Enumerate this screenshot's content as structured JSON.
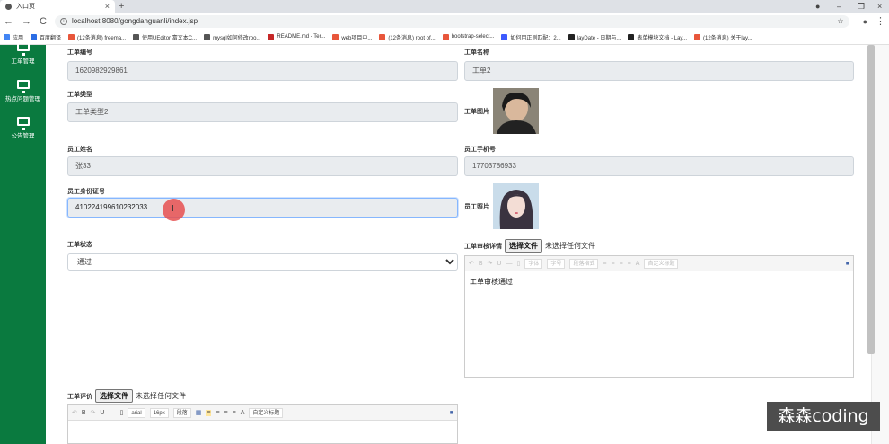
{
  "browser": {
    "tab_title": "入口页",
    "url": "localhost:8080/gongdanguanli/index.jsp",
    "bookmarks": [
      {
        "label": "应用",
        "color": "#4285f4"
      },
      {
        "label": "百度翻译",
        "color": "#2b6de5"
      },
      {
        "label": "(12条消息) freema...",
        "color": "#e8563b"
      },
      {
        "label": "使用UEditor 富文本C...",
        "color": "#555555"
      },
      {
        "label": "mysql如何修改roo...",
        "color": "#555555"
      },
      {
        "label": "README.md - Ter...",
        "color": "#c62828"
      },
      {
        "label": "web项目中...",
        "color": "#e8563b"
      },
      {
        "label": "(12条消息) root of...",
        "color": "#e8563b"
      },
      {
        "label": "bootstrap-select...",
        "color": "#e8563b"
      },
      {
        "label": "如何用正则匹配：2...",
        "color": "#3d5afe"
      },
      {
        "label": "layDate - 日期与...",
        "color": "#222222"
      },
      {
        "label": "表单模块文档 - Lay...",
        "color": "#222222"
      },
      {
        "label": "(12条消息) 关于lay...",
        "color": "#e8563b"
      }
    ]
  },
  "sidebar": {
    "items": [
      {
        "label": "工单管理",
        "icon": "monitor-icon"
      },
      {
        "label": "热点问题管理",
        "icon": "monitor-icon"
      },
      {
        "label": "公告管理",
        "icon": "monitor-icon"
      }
    ]
  },
  "form": {
    "ticket_no_label": "工单编号",
    "ticket_no_value": "1620982929861",
    "ticket_name_label": "工单名称",
    "ticket_name_value": "工单2",
    "ticket_type_label": "工单类型",
    "ticket_type_value": "工单类型2",
    "ticket_image_label": "工单图片",
    "employee_name_label": "员工姓名",
    "employee_name_value": "张33",
    "employee_phone_label": "员工手机号",
    "employee_phone_value": "17703786933",
    "employee_id_label": "员工身份证号",
    "employee_id_value": "410224199610232033",
    "employee_photo_label": "员工照片",
    "status_label": "工单状态",
    "status_value": "通过",
    "review_detail_label": "工单审核详情",
    "choose_file": "选择文件",
    "no_file": "未选择任何文件",
    "review_text": "工单审核通过",
    "evaluation_label": "工单评价",
    "editor_font": "arial",
    "editor_size": "16px",
    "editor_paragraph": "段落",
    "editor_custom_title": "自定义标题",
    "review_font": "字体",
    "review_size": "字号",
    "review_paragraph": "段落格式",
    "review_custom_title": "自定义标题"
  },
  "watermark": "森森coding"
}
